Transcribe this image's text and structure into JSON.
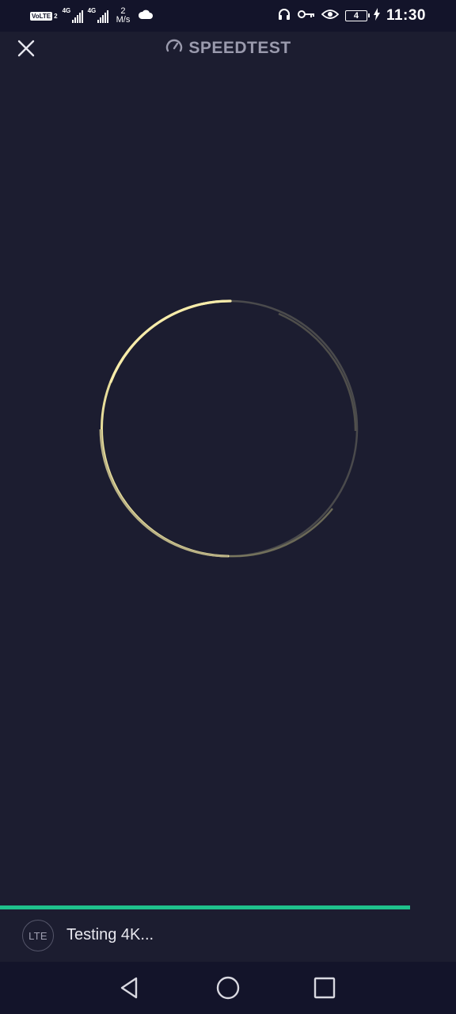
{
  "status_bar": {
    "volte": "VoLTE",
    "volte_sim": "2",
    "sim1_network": "4G",
    "sim2_network": "4G",
    "net_speed_value": "2",
    "net_speed_unit": "M/s",
    "battery_level": "4",
    "time": "11:30",
    "icons": [
      "cloud-icon",
      "headset-icon",
      "vpn-key-icon",
      "eye-icon",
      "battery-icon",
      "charging-bolt-icon"
    ]
  },
  "header": {
    "title": "SPEEDTEST",
    "close_icon": "close-icon",
    "logo_icon": "speedometer-icon"
  },
  "gauge": {
    "state": "loading",
    "accent_color": "#f5e9a0"
  },
  "progress": {
    "fraction": 0.9,
    "color": "#1fc18c"
  },
  "footer": {
    "connection_type": "LTE",
    "status": "Testing 4K..."
  },
  "nav": {
    "back_icon": "back-triangle-icon",
    "home_icon": "home-circle-icon",
    "recents_icon": "recents-square-icon"
  }
}
